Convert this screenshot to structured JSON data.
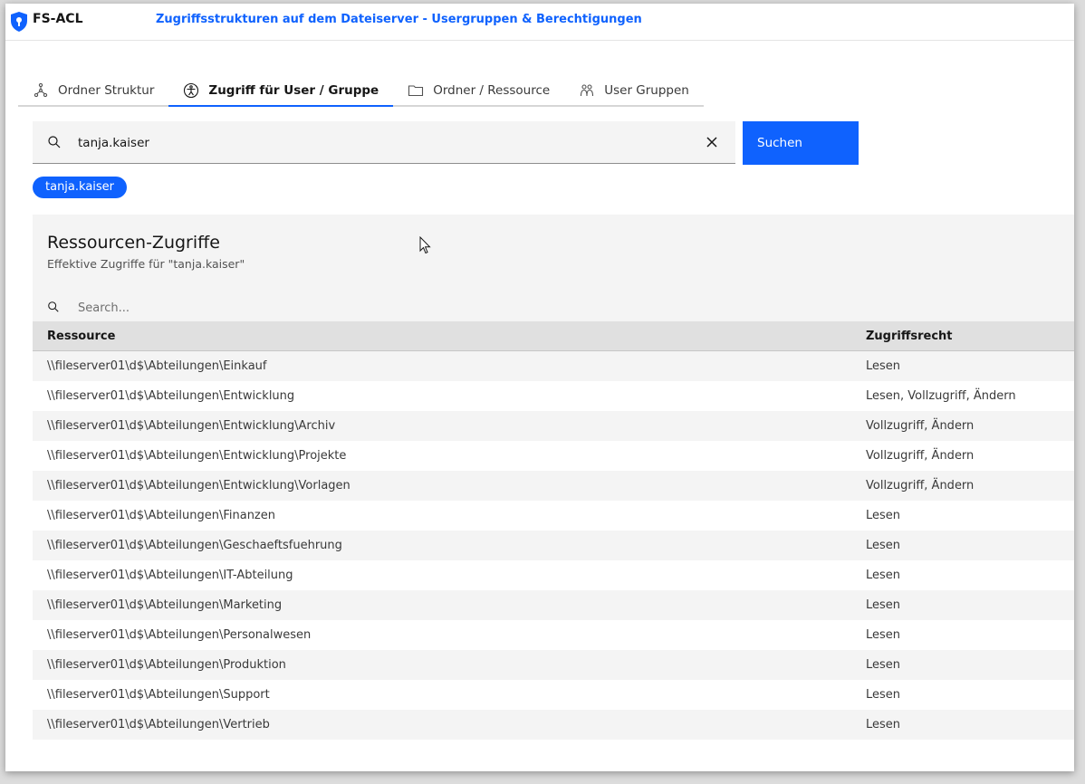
{
  "app": {
    "name": "FS-ACL",
    "subtitle": "Zugriffsstrukturen auf dem Dateiserver - Usergruppen & Berechtigungen"
  },
  "tabs": [
    {
      "label": "Ordner Struktur",
      "icon": "tree-icon",
      "active": false
    },
    {
      "label": "Zugriff für User / Gruppe",
      "icon": "accessibility-icon",
      "active": true
    },
    {
      "label": "Ordner / Ressource",
      "icon": "folder-icon",
      "active": false
    },
    {
      "label": "User Gruppen",
      "icon": "user-group-icon",
      "active": false
    }
  ],
  "search": {
    "value": "tanja.kaiser",
    "button_label": "Suchen"
  },
  "selected_tag": "tanja.kaiser",
  "panel": {
    "title": "Ressourcen-Zugriffe",
    "subtitle": "Effektive Zugriffe für \"tanja.kaiser\"",
    "search_placeholder": "Search...",
    "columns": [
      "Ressource",
      "Zugriffsrecht"
    ],
    "rows": [
      {
        "resource": "\\\\fileserver01\\d$\\Abteilungen\\Einkauf",
        "right": "Lesen"
      },
      {
        "resource": "\\\\fileserver01\\d$\\Abteilungen\\Entwicklung",
        "right": "Lesen, Vollzugriff, Ändern"
      },
      {
        "resource": "\\\\fileserver01\\d$\\Abteilungen\\Entwicklung\\Archiv",
        "right": "Vollzugriff, Ändern"
      },
      {
        "resource": "\\\\fileserver01\\d$\\Abteilungen\\Entwicklung\\Projekte",
        "right": "Vollzugriff, Ändern"
      },
      {
        "resource": "\\\\fileserver01\\d$\\Abteilungen\\Entwicklung\\Vorlagen",
        "right": "Vollzugriff, Ändern"
      },
      {
        "resource": "\\\\fileserver01\\d$\\Abteilungen\\Finanzen",
        "right": "Lesen"
      },
      {
        "resource": "\\\\fileserver01\\d$\\Abteilungen\\Geschaeftsfuehrung",
        "right": "Lesen"
      },
      {
        "resource": "\\\\fileserver01\\d$\\Abteilungen\\IT-Abteilung",
        "right": "Lesen"
      },
      {
        "resource": "\\\\fileserver01\\d$\\Abteilungen\\Marketing",
        "right": "Lesen"
      },
      {
        "resource": "\\\\fileserver01\\d$\\Abteilungen\\Personalwesen",
        "right": "Lesen"
      },
      {
        "resource": "\\\\fileserver01\\d$\\Abteilungen\\Produktion",
        "right": "Lesen"
      },
      {
        "resource": "\\\\fileserver01\\d$\\Abteilungen\\Support",
        "right": "Lesen"
      },
      {
        "resource": "\\\\fileserver01\\d$\\Abteilungen\\Vertrieb",
        "right": "Lesen"
      }
    ]
  },
  "colors": {
    "accent": "#0f62fe",
    "panel_bg": "#f4f4f4",
    "header_bg": "#e0e0e0"
  }
}
